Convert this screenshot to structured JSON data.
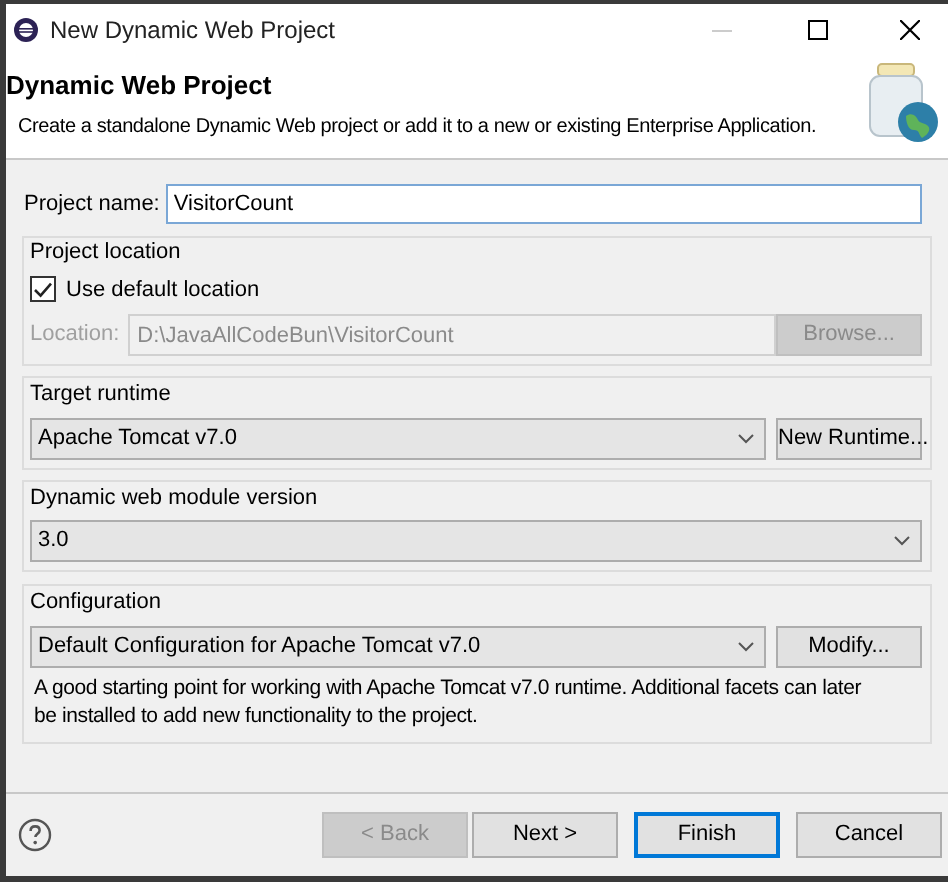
{
  "window": {
    "title": "New Dynamic Web Project"
  },
  "banner": {
    "title": "Dynamic Web Project",
    "description": "Create a standalone Dynamic Web project or add it to a new or existing Enterprise Application."
  },
  "project_name": {
    "label": "Project name:",
    "value": "VisitorCount"
  },
  "project_location": {
    "title": "Project location",
    "use_default": {
      "label": "Use default location",
      "checked": true
    },
    "location": {
      "label": "Location:",
      "value": "D:\\JavaAllCodeBun\\VisitorCount",
      "disabled": true
    },
    "browse": {
      "label": "Browse...",
      "disabled": true
    }
  },
  "target_runtime": {
    "title": "Target runtime",
    "value": "Apache Tomcat v7.0",
    "button": "New Runtime..."
  },
  "module_version": {
    "title": "Dynamic web module version",
    "value": "3.0"
  },
  "configuration": {
    "title": "Configuration",
    "value": "Default Configuration for Apache Tomcat v7.0",
    "button": "Modify...",
    "description": "A good starting point for working with Apache Tomcat v7.0 runtime. Additional facets can later be installed to add new functionality to the project."
  },
  "buttons": [
    {
      "label": "< Back",
      "disabled": true,
      "default": false
    },
    {
      "label": "Next >",
      "disabled": false,
      "default": false
    },
    {
      "label": "Finish",
      "disabled": false,
      "default": true
    },
    {
      "label": "Cancel",
      "disabled": false,
      "default": false
    }
  ]
}
